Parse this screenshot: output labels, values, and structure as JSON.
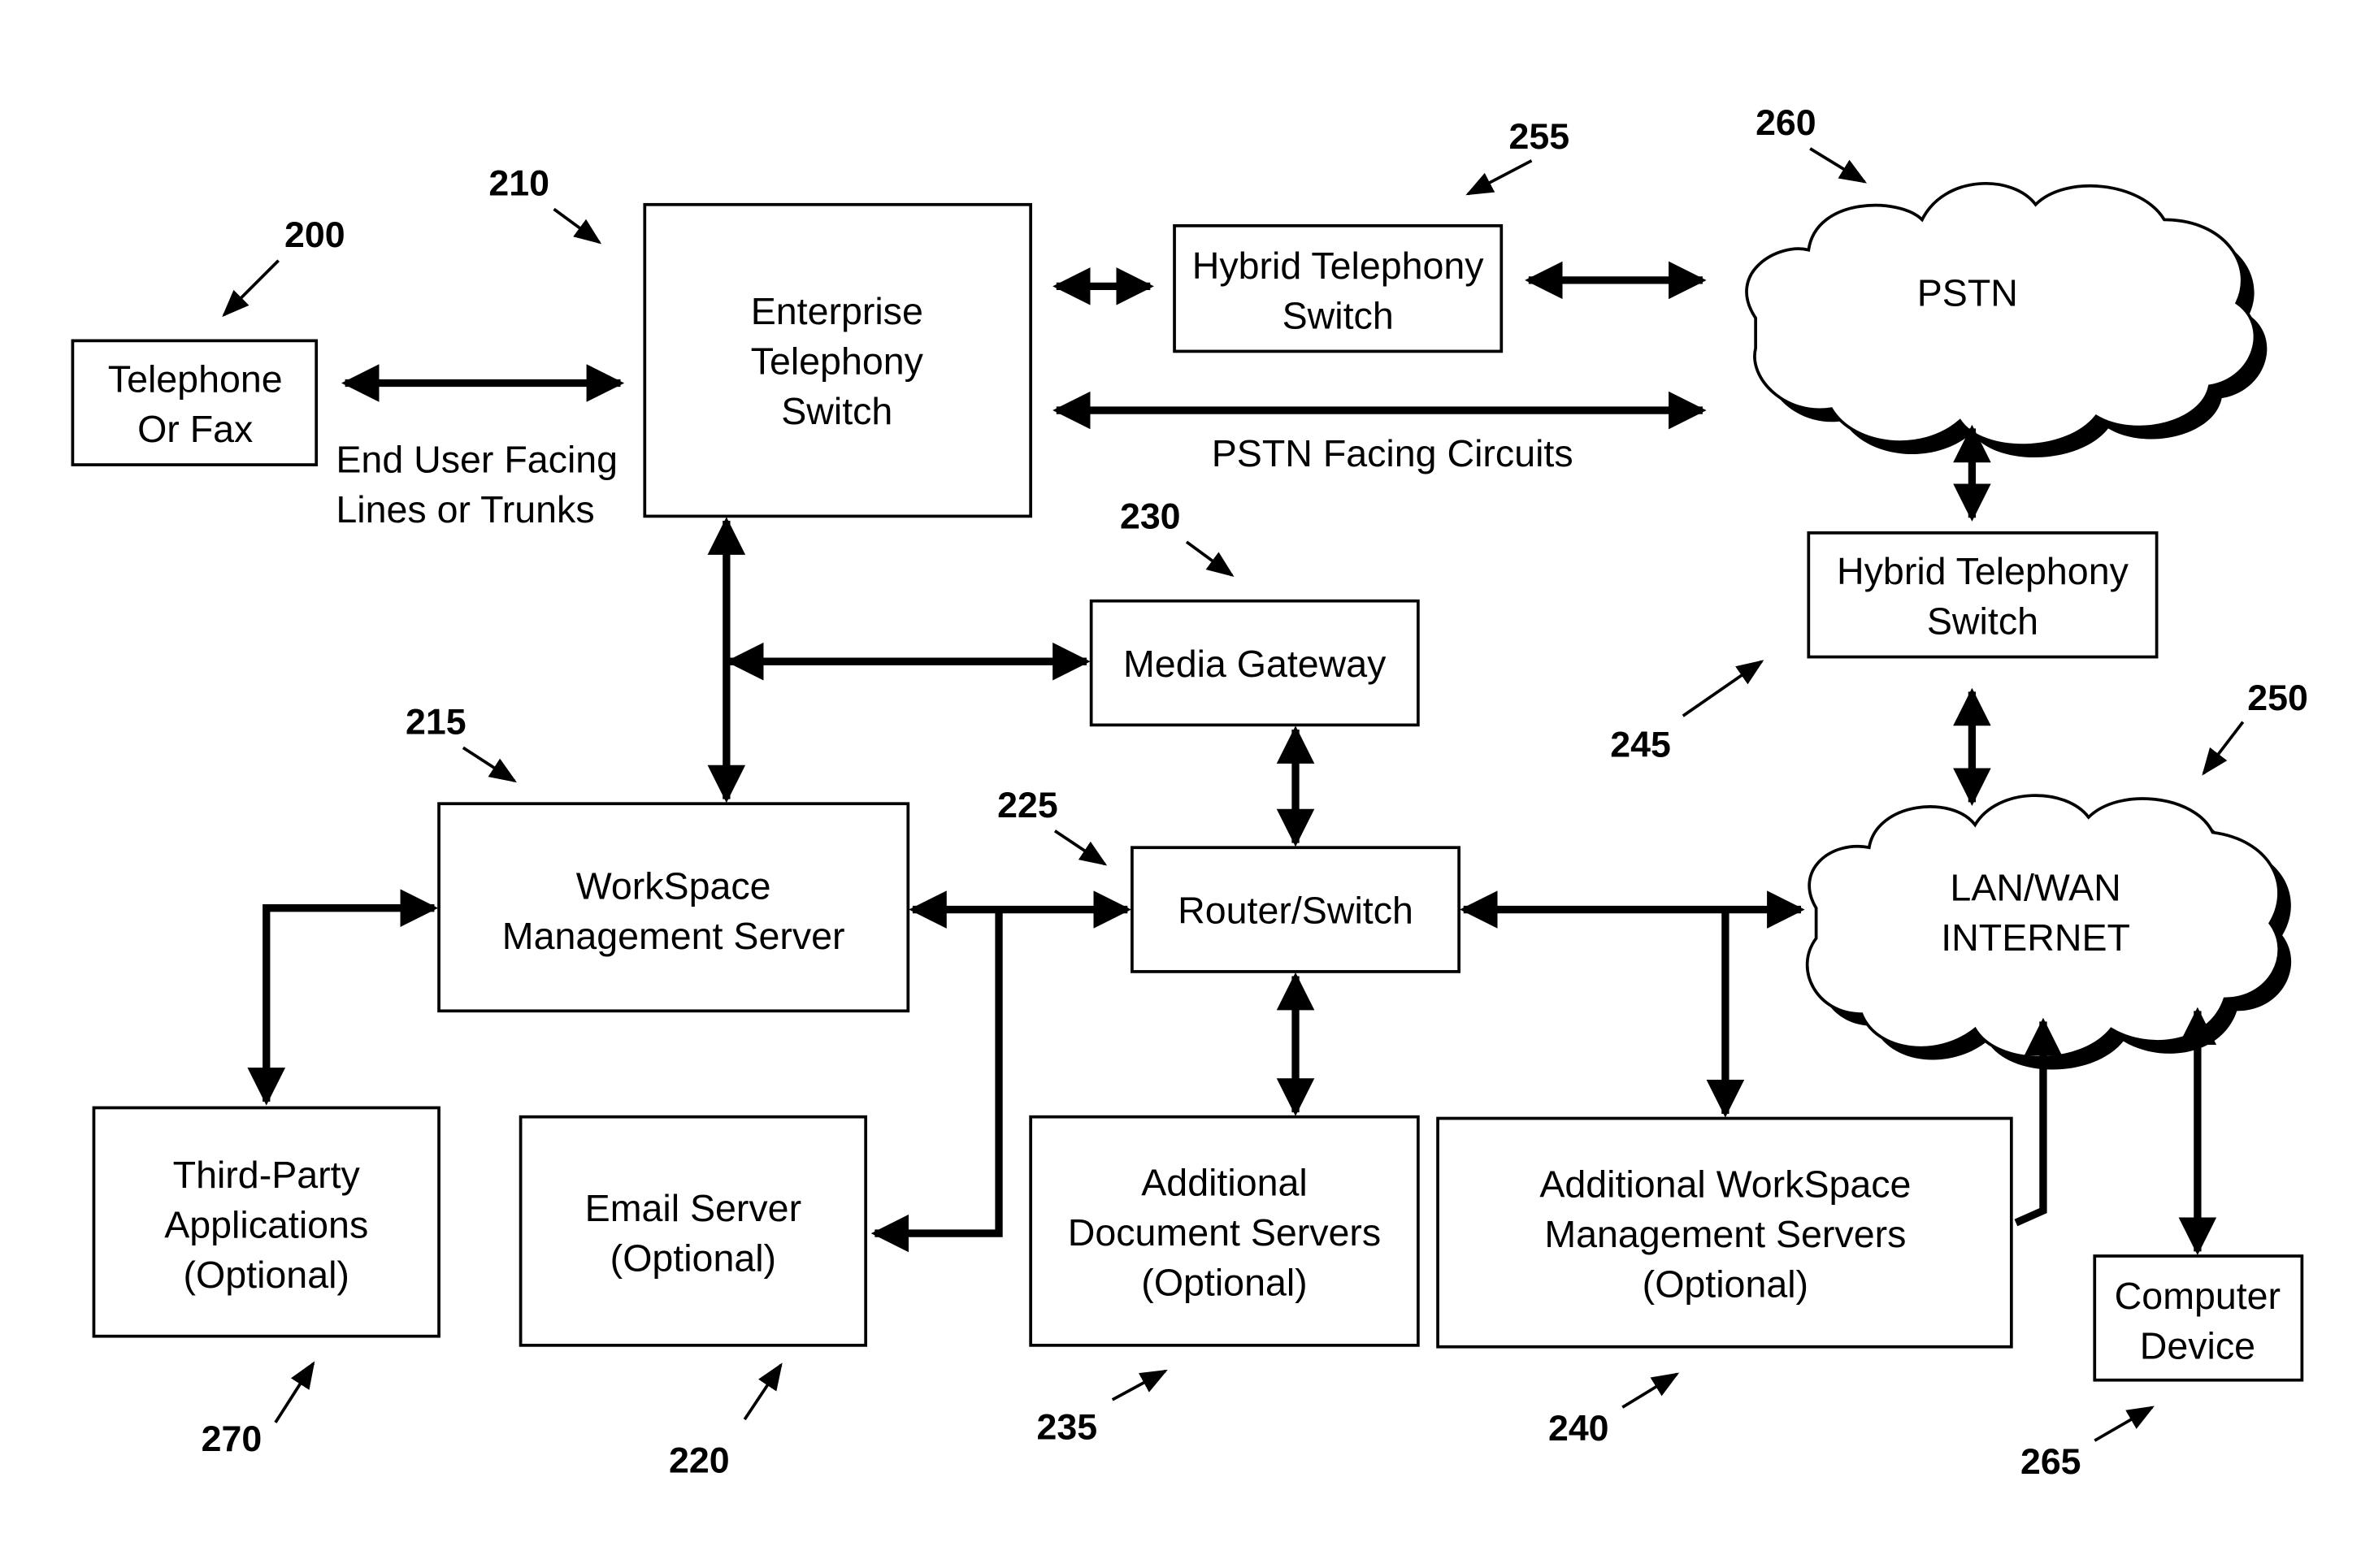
{
  "diagram": {
    "nodes": [
      {
        "id": "200",
        "ref": "200",
        "lines": [
          "Telephone",
          "Or Fax"
        ]
      },
      {
        "id": "210",
        "ref": "210",
        "lines": [
          "Enterprise",
          "Telephony",
          "Switch"
        ]
      },
      {
        "id": "255",
        "ref": "255",
        "lines": [
          "Hybrid Telephony",
          "Switch"
        ]
      },
      {
        "id": "260",
        "ref": "260",
        "lines": [
          "PSTN"
        ]
      },
      {
        "id": "245",
        "ref": "245",
        "lines": [
          "Hybrid Telephony",
          "Switch"
        ]
      },
      {
        "id": "230",
        "ref": "230",
        "lines": [
          "Media Gateway"
        ]
      },
      {
        "id": "215",
        "ref": "215",
        "lines": [
          "WorkSpace",
          "Management Server"
        ]
      },
      {
        "id": "225",
        "ref": "225",
        "lines": [
          "Router/Switch"
        ]
      },
      {
        "id": "250",
        "ref": "250",
        "lines": [
          "LAN/WAN",
          "INTERNET"
        ]
      },
      {
        "id": "270",
        "ref": "270",
        "lines": [
          "Third-Party",
          "Applications",
          "(Optional)"
        ]
      },
      {
        "id": "220",
        "ref": "220",
        "lines": [
          "Email Server",
          "(Optional)"
        ]
      },
      {
        "id": "235",
        "ref": "235",
        "lines": [
          "Additional",
          "Document Servers",
          "(Optional)"
        ]
      },
      {
        "id": "240",
        "ref": "240",
        "lines": [
          "Additional WorkSpace",
          "Management Servers",
          "(Optional)"
        ]
      },
      {
        "id": "265",
        "ref": "265",
        "lines": [
          "Computer",
          "Device"
        ]
      }
    ],
    "edge_labels": {
      "end_user": [
        "End User Facing",
        "Lines or Trunks"
      ],
      "pstn_facing": "PSTN Facing Circuits"
    },
    "edges": [
      {
        "from": "200",
        "to": "210",
        "label": "End User Facing Lines or Trunks"
      },
      {
        "from": "210",
        "to": "255"
      },
      {
        "from": "255",
        "to": "260"
      },
      {
        "from": "210",
        "to": "260",
        "label": "PSTN Facing Circuits"
      },
      {
        "from": "260",
        "to": "245"
      },
      {
        "from": "245",
        "to": "250"
      },
      {
        "from": "210",
        "to": "215"
      },
      {
        "from": "210",
        "to": "230"
      },
      {
        "from": "230",
        "to": "225"
      },
      {
        "from": "215",
        "to": "225"
      },
      {
        "from": "215",
        "to": "220"
      },
      {
        "from": "215",
        "to": "270"
      },
      {
        "from": "225",
        "to": "235"
      },
      {
        "from": "225",
        "to": "250"
      },
      {
        "from": "225",
        "to": "240"
      },
      {
        "from": "240",
        "to": "250"
      },
      {
        "from": "265",
        "to": "250"
      }
    ]
  }
}
